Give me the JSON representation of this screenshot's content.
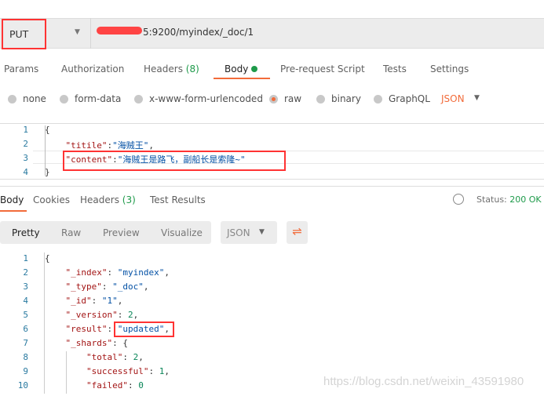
{
  "request": {
    "method": "PUT",
    "url": "5:9200/myindex/_doc/1",
    "tabs": [
      {
        "label": "Params"
      },
      {
        "label": "Authorization"
      },
      {
        "label": "Headers",
        "count": "(8)"
      },
      {
        "label": "Body",
        "active": true
      },
      {
        "label": "Pre-request Script"
      },
      {
        "label": "Tests"
      },
      {
        "label": "Settings"
      }
    ],
    "body_types": [
      "none",
      "form-data",
      "x-www-form-urlencoded",
      "raw",
      "binary",
      "GraphQL"
    ],
    "selected_body_type": "raw",
    "raw_format": "JSON",
    "editor_lines": [
      [
        {
          "t": "{",
          "c": "p"
        }
      ],
      [
        {
          "t": "    ",
          "c": "p"
        },
        {
          "t": "\"titile\"",
          "c": "k"
        },
        {
          "t": ":",
          "c": "p"
        },
        {
          "t": "\"海贼王\"",
          "c": "s"
        },
        {
          "t": ",",
          "c": "p"
        }
      ],
      [
        {
          "t": "    ",
          "c": "p"
        },
        {
          "t": "\"content\"",
          "c": "k"
        },
        {
          "t": ":",
          "c": "p"
        },
        {
          "t": "\"海贼王是路飞，副船长是索隆~\"",
          "c": "s"
        }
      ],
      [
        {
          "t": "}",
          "c": "p"
        }
      ]
    ]
  },
  "response": {
    "tabs": [
      {
        "label": "Body",
        "active": true
      },
      {
        "label": "Cookies"
      },
      {
        "label": "Headers",
        "count": "(3)"
      },
      {
        "label": "Test Results"
      }
    ],
    "status_label": "Status:",
    "status_value": "200 OK",
    "view_modes": [
      "Pretty",
      "Raw",
      "Preview",
      "Visualize"
    ],
    "active_view": "Pretty",
    "format": "JSON",
    "lines": [
      [
        {
          "t": "{",
          "c": "p"
        }
      ],
      [
        {
          "t": "    ",
          "c": "p"
        },
        {
          "t": "\"_index\"",
          "c": "k"
        },
        {
          "t": ": ",
          "c": "p"
        },
        {
          "t": "\"myindex\"",
          "c": "s"
        },
        {
          "t": ",",
          "c": "p"
        }
      ],
      [
        {
          "t": "    ",
          "c": "p"
        },
        {
          "t": "\"_type\"",
          "c": "k"
        },
        {
          "t": ": ",
          "c": "p"
        },
        {
          "t": "\"_doc\"",
          "c": "s"
        },
        {
          "t": ",",
          "c": "p"
        }
      ],
      [
        {
          "t": "    ",
          "c": "p"
        },
        {
          "t": "\"_id\"",
          "c": "k"
        },
        {
          "t": ": ",
          "c": "p"
        },
        {
          "t": "\"1\"",
          "c": "s"
        },
        {
          "t": ",",
          "c": "p"
        }
      ],
      [
        {
          "t": "    ",
          "c": "p"
        },
        {
          "t": "\"_version\"",
          "c": "k"
        },
        {
          "t": ": ",
          "c": "p"
        },
        {
          "t": "2",
          "c": "n"
        },
        {
          "t": ",",
          "c": "p"
        }
      ],
      [
        {
          "t": "    ",
          "c": "p"
        },
        {
          "t": "\"result\"",
          "c": "k"
        },
        {
          "t": ": ",
          "c": "p"
        },
        {
          "t": "\"updated\"",
          "c": "s"
        },
        {
          "t": ",",
          "c": "p"
        }
      ],
      [
        {
          "t": "    ",
          "c": "p"
        },
        {
          "t": "\"_shards\"",
          "c": "k"
        },
        {
          "t": ": {",
          "c": "p"
        }
      ],
      [
        {
          "t": "        ",
          "c": "p"
        },
        {
          "t": "\"total\"",
          "c": "k"
        },
        {
          "t": ": ",
          "c": "p"
        },
        {
          "t": "2",
          "c": "n"
        },
        {
          "t": ",",
          "c": "p"
        }
      ],
      [
        {
          "t": "        ",
          "c": "p"
        },
        {
          "t": "\"successful\"",
          "c": "k"
        },
        {
          "t": ": ",
          "c": "p"
        },
        {
          "t": "1",
          "c": "n"
        },
        {
          "t": ",",
          "c": "p"
        }
      ],
      [
        {
          "t": "        ",
          "c": "p"
        },
        {
          "t": "\"failed\"",
          "c": "k"
        },
        {
          "t": ": ",
          "c": "p"
        },
        {
          "t": "0",
          "c": "n"
        }
      ]
    ]
  },
  "watermark": "https://blog.csdn.net/weixin_43591980",
  "colors": {
    "accent": "#f26b3a",
    "success": "#1e9a4a",
    "highlight_box": "#ff3333"
  }
}
